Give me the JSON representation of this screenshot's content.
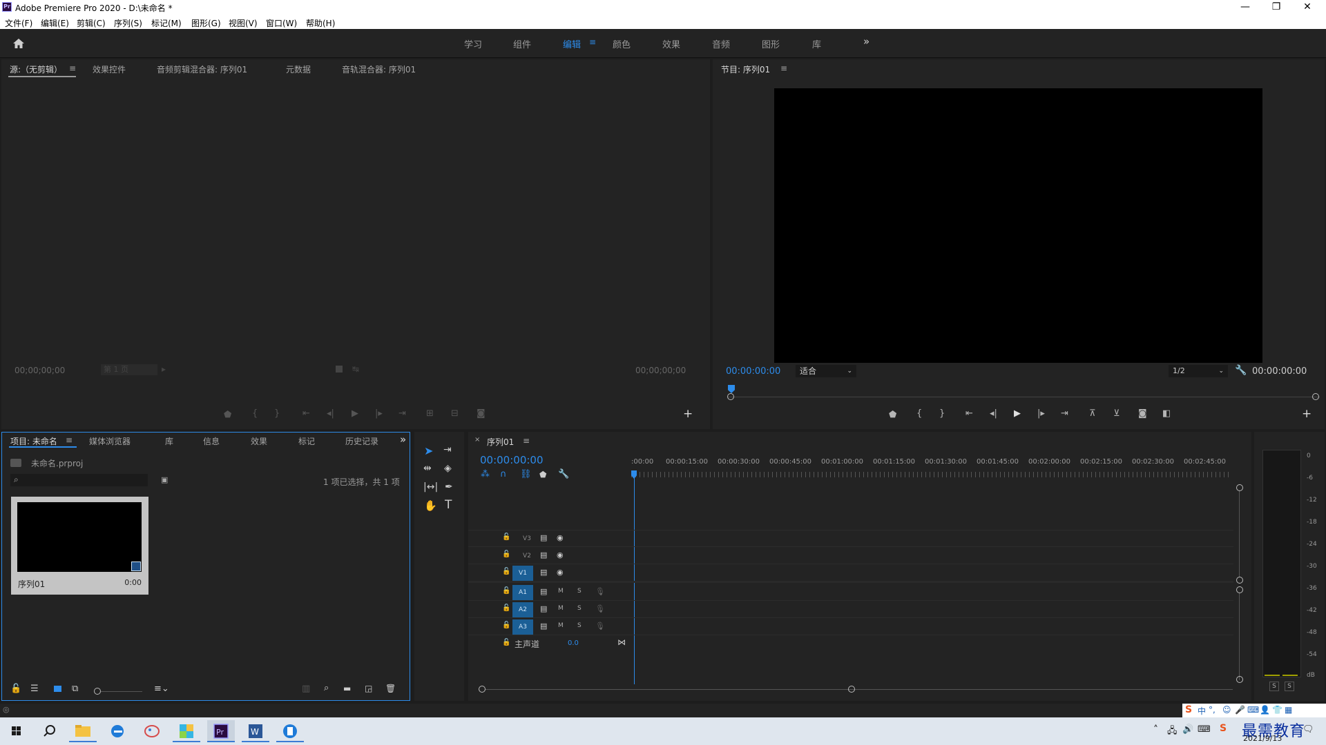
{
  "window": {
    "app_icon_text": "Pr",
    "title": "Adobe Premiere Pro 2020 - D:\\未命名 *",
    "minimize": "—",
    "restore": "❐",
    "close": "✕"
  },
  "menu": [
    "文件(F)",
    "编辑(E)",
    "剪辑(C)",
    "序列(S)",
    "标记(M)",
    "图形(G)",
    "视图(V)",
    "窗口(W)",
    "帮助(H)"
  ],
  "workspaces": {
    "tabs": [
      "学习",
      "组件",
      "编辑",
      "颜色",
      "效果",
      "音频",
      "图形",
      "库"
    ],
    "active": "编辑",
    "more": "»"
  },
  "source_panel": {
    "tabs": [
      "源:（无剪辑）",
      "效果控件",
      "音频剪辑混合器: 序列01",
      "元数据",
      "音轨混合器: 序列01"
    ],
    "timecode_left": "00;00;00;00",
    "page": "第 1 页",
    "timecode_right": "00;00;00;00"
  },
  "program_panel": {
    "title": "节目: 序列01",
    "timecode_left": "00:00:00:00",
    "fit": "适合",
    "resolution": "1/2",
    "timecode_right": "00:00:00:00"
  },
  "project_panel": {
    "tabs": [
      "项目: 未命名",
      "媒体浏览器",
      "库",
      "信息",
      "效果",
      "标记",
      "历史记录"
    ],
    "file": "未命名.prproj",
    "selection_info": "1 项已选择，共 1 项",
    "item": {
      "name": "序列01",
      "duration": "0:00"
    }
  },
  "timeline": {
    "title": "序列01",
    "timecode": "00:00:00:00",
    "ruler": [
      ":00:00",
      "00:00:15:00",
      "00:00:30:00",
      "00:00:45:00",
      "00:01:00:00",
      "00:01:15:00",
      "00:01:30:00",
      "00:01:45:00",
      "00:02:00:00",
      "00:02:15:00",
      "00:02:30:00",
      "00:02:45:00"
    ],
    "video_tracks": [
      "V3",
      "V2",
      "V1"
    ],
    "audio_tracks": [
      "A1",
      "A2",
      "A3"
    ],
    "master": "主声道",
    "master_value": "0.0",
    "mute": "M",
    "solo": "S"
  },
  "meter": {
    "scale": [
      "0",
      "-6",
      "-12",
      "-18",
      "-24",
      "-30",
      "-36",
      "-42",
      "-48",
      "-54",
      "dB"
    ],
    "solo_left": "S",
    "solo_right": "S"
  },
  "ime": {
    "lang": "中",
    "punct": "°,"
  },
  "watermark": "最需教育",
  "taskbar": {
    "date": "2021/9/13"
  },
  "colors": {
    "accent": "#2d8ceb",
    "panel": "#232323",
    "selected_track": "#1b5f96",
    "playhead": "#2d8ceb"
  }
}
